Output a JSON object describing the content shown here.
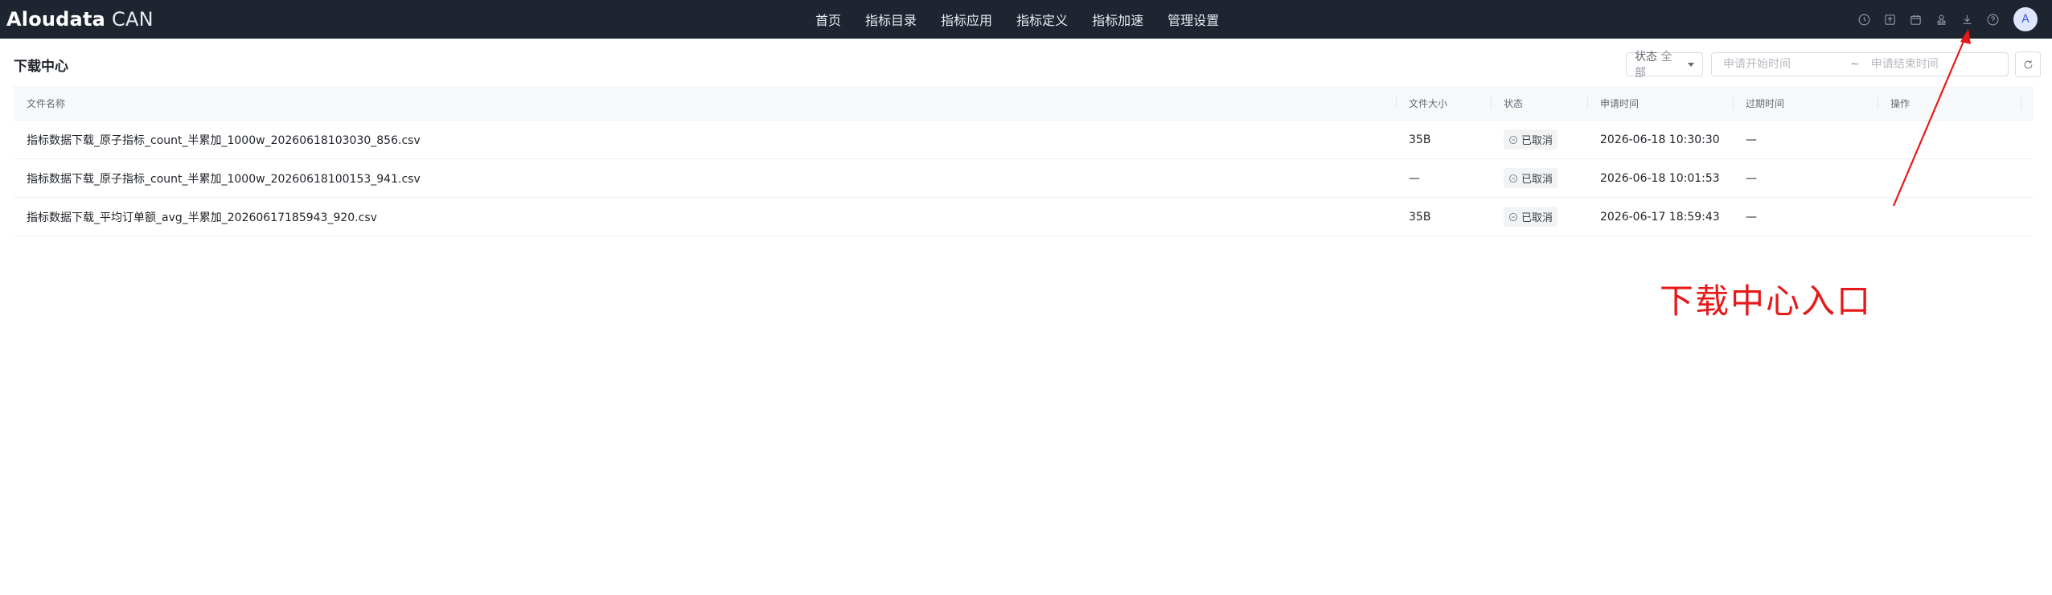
{
  "app": {
    "brand": "Aloudata",
    "product": "CAN"
  },
  "nav": {
    "items": [
      "首页",
      "指标目录",
      "指标应用",
      "指标定义",
      "指标加速",
      "管理设置"
    ]
  },
  "header_icons": [
    "clock-icon",
    "upload-icon",
    "calendar-icon",
    "stamp-icon",
    "download-icon",
    "help-icon"
  ],
  "user": {
    "avatar_initial": "A"
  },
  "page": {
    "title": "下载中心"
  },
  "filters": {
    "status_label": "状态",
    "status_value": "全部",
    "start_placeholder": "申请开始时间",
    "range_separator": "~",
    "end_placeholder": "申请结束时间"
  },
  "table": {
    "columns": [
      "文件名称",
      "文件大小",
      "状态",
      "申请时间",
      "过期时间",
      "操作"
    ],
    "rows": [
      {
        "name": "指标数据下载_原子指标_count_半累加_1000w_20260618103030_856.csv",
        "size": "35B",
        "status": "已取消",
        "apply_time": "2026-06-18 10:30:30",
        "expire_time": "—",
        "action": ""
      },
      {
        "name": "指标数据下载_原子指标_count_半累加_1000w_20260618100153_941.csv",
        "size": "—",
        "status": "已取消",
        "apply_time": "2026-06-18 10:01:53",
        "expire_time": "—",
        "action": ""
      },
      {
        "name": "指标数据下载_平均订单额_avg_半累加_20260617185943_920.csv",
        "size": "35B",
        "status": "已取消",
        "apply_time": "2026-06-17 18:59:43",
        "expire_time": "—",
        "action": ""
      }
    ]
  },
  "annotation": {
    "text": "下载中心入口",
    "color": "#e61919"
  },
  "colors": {
    "topbar": "#1e2530",
    "accent": "#3b5bdb"
  }
}
